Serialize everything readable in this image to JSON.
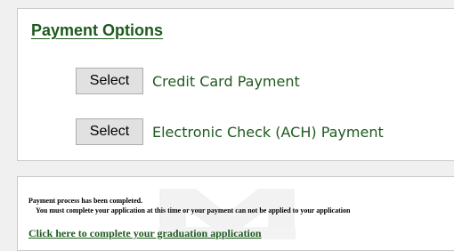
{
  "payment_options": {
    "title": "Payment Options",
    "options": [
      {
        "button_label": "Select",
        "label": "Credit Card Payment"
      },
      {
        "button_label": "Select",
        "label": "Electronic Check (ACH) Payment"
      }
    ]
  },
  "status": {
    "line1": "Payment process has been completed.",
    "line2": "You must complete your application at this time or your payment can not be applied to your application",
    "link_text": "Click here to complete your graduation application"
  },
  "colors": {
    "accent_green": "#1e5a1e",
    "background": "#f0f0f0",
    "panel": "#ffffff",
    "button_face": "#e1e1e1"
  },
  "icons": {
    "watermark": "university-logo-watermark"
  }
}
